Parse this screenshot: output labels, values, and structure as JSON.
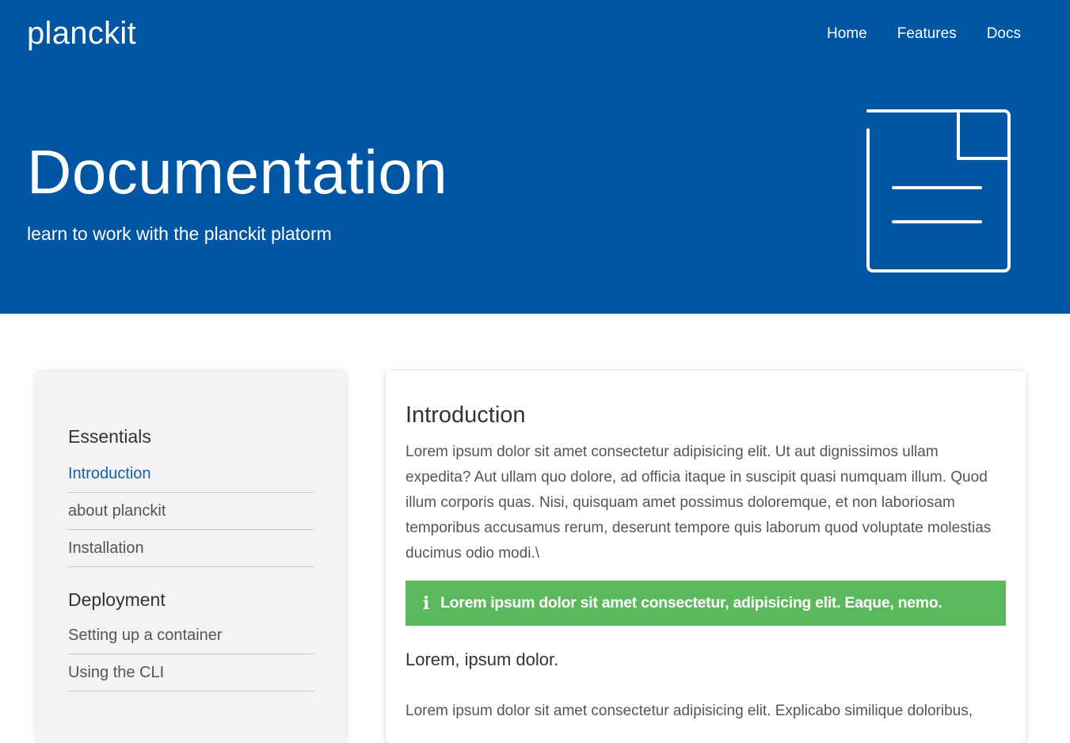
{
  "header": {
    "brand": "planckit",
    "nav": [
      "Home",
      "Features",
      "Docs"
    ]
  },
  "hero": {
    "title": "Documentation",
    "subtitle": "learn to work with the planckit platorm",
    "icon": "document-icon"
  },
  "sidebar": {
    "sections": [
      {
        "heading": "Essentials",
        "items": [
          "Introduction",
          "about planckit",
          "Installation"
        ]
      },
      {
        "heading": "Deployment",
        "items": [
          "Setting up a container",
          "Using the CLI"
        ]
      }
    ],
    "active_item": "Introduction"
  },
  "content": {
    "title": "Introduction",
    "paragraph1": "Lorem ipsum dolor sit amet consectetur adipisicing elit. Ut aut dignissimos ullam expedita? Aut ullam quo dolore, ad officia itaque in suscipit quasi numquam illum. Quod illum corporis quas. Nisi, quisquam amet possimus doloremque, et non laboriosam temporibus accusamus rerum, deserunt tempore quis laborum quod voluptate molestias ducimus odio modi.\\",
    "alert": {
      "icon": "info-icon",
      "text": "Lorem ipsum dolor sit amet consectetur, adipisicing elit. Eaque, nemo."
    },
    "subtitle": "Lorem, ipsum dolor.",
    "paragraph2": "Lorem ipsum dolor sit amet consectetur adipisicing elit. Explicabo similique doloribus,"
  },
  "colors": {
    "primary": "#0056a2",
    "alert_success": "#5cb85c",
    "active_link": "#1c5fa3",
    "sidebar_bg": "#f3f3f3"
  }
}
